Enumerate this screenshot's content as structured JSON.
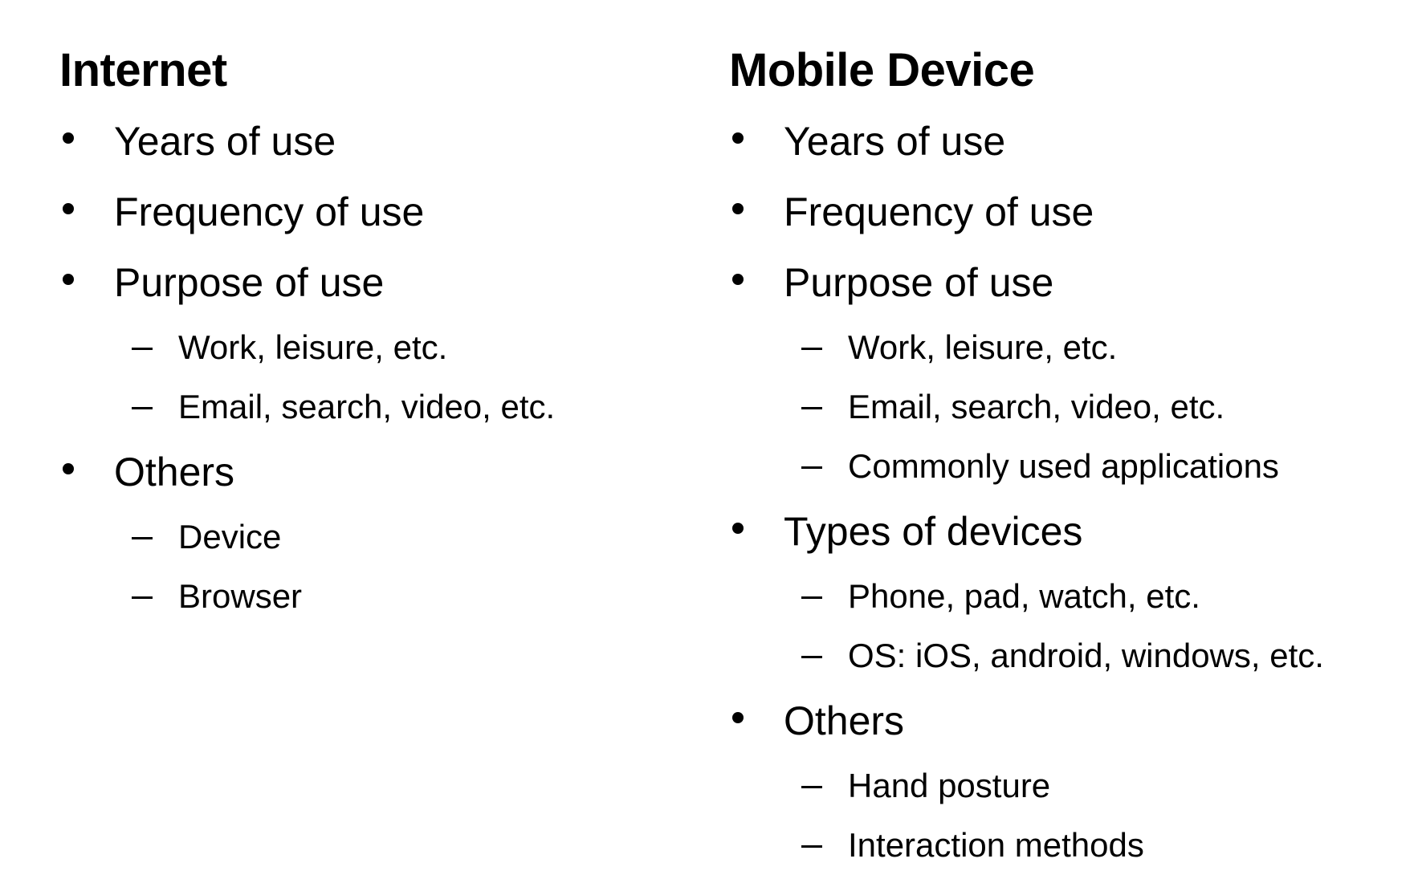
{
  "internet": {
    "heading": "Internet",
    "items": [
      {
        "label": "Years of use",
        "subs": []
      },
      {
        "label": "Frequency of use",
        "subs": []
      },
      {
        "label": "Purpose of use",
        "subs": [
          "Work, leisure, etc.",
          "Email, search, video, etc."
        ]
      },
      {
        "label": "Others",
        "subs": [
          "Device",
          "Browser"
        ]
      }
    ]
  },
  "mobile": {
    "heading": "Mobile Device",
    "items": [
      {
        "label": "Years of use",
        "subs": []
      },
      {
        "label": "Frequency of use",
        "subs": []
      },
      {
        "label": "Purpose of use",
        "subs": [
          "Work, leisure, etc.",
          "Email, search, video, etc.",
          "Commonly used applications"
        ]
      },
      {
        "label": "Types of devices",
        "subs": [
          "Phone, pad, watch, etc.",
          "OS: iOS, android, windows, etc."
        ]
      },
      {
        "label": "Others",
        "subs": [
          "Hand posture",
          "Interaction methods"
        ]
      }
    ]
  }
}
